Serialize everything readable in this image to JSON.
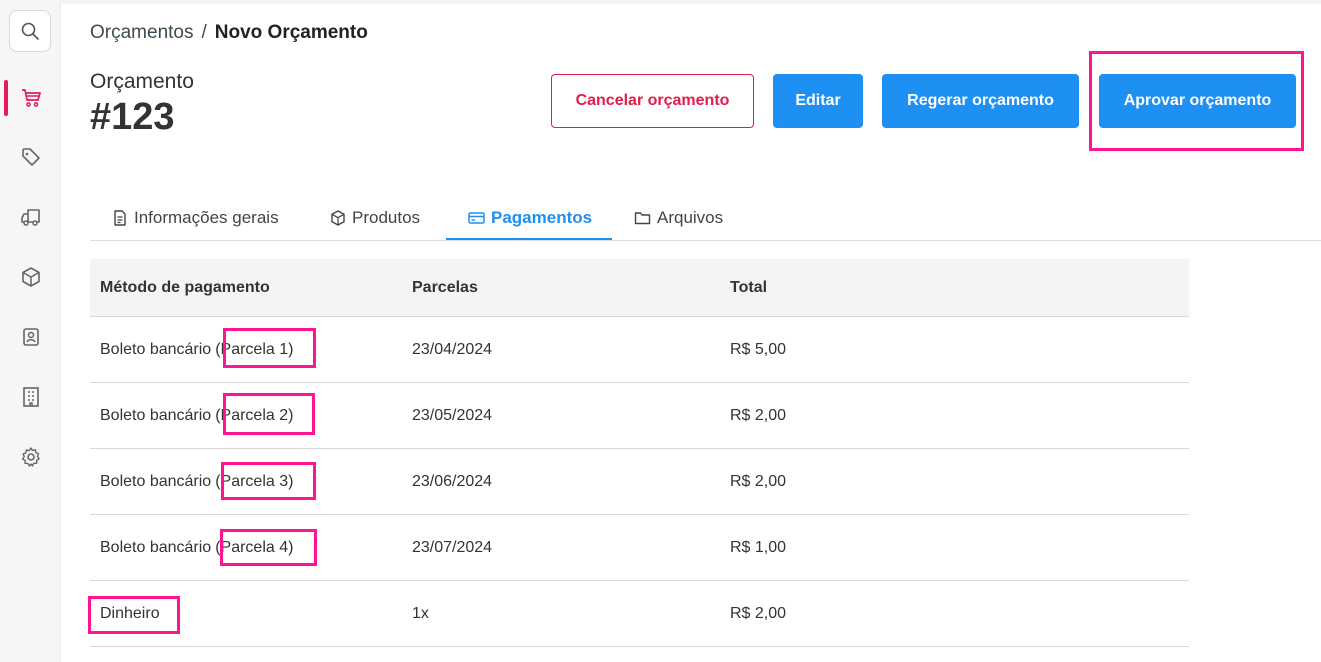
{
  "breadcrumb": {
    "parent": "Orçamentos",
    "separator": "/",
    "current": "Novo Orçamento"
  },
  "header": {
    "label": "Orçamento",
    "number": "#123"
  },
  "actions": {
    "cancel_label": "Cancelar orçamento",
    "edit_label": "Editar",
    "regen_label": "Regerar orçamento",
    "approve_label": "Aprovar orçamento"
  },
  "sidebar": {
    "items": [
      {
        "icon": "search-icon"
      },
      {
        "icon": "cart-icon",
        "active": true
      },
      {
        "icon": "tag-icon"
      },
      {
        "icon": "truck-icon"
      },
      {
        "icon": "box-icon"
      },
      {
        "icon": "contact-icon"
      },
      {
        "icon": "building-icon"
      },
      {
        "icon": "gear-icon"
      }
    ]
  },
  "tabs": [
    {
      "label": "Informações gerais",
      "icon": "document-icon"
    },
    {
      "label": "Produtos",
      "icon": "box-icon"
    },
    {
      "label": "Pagamentos",
      "icon": "card-icon",
      "active": true
    },
    {
      "label": "Arquivos",
      "icon": "folder-icon"
    }
  ],
  "table": {
    "headers": [
      "Método de pagamento",
      "Parcelas",
      "Total"
    ],
    "rows": [
      {
        "method": "Boleto bancário",
        "detail": "(Parcela 1)",
        "installments": "23/04/2024",
        "total": "R$ 5,00"
      },
      {
        "method": "Boleto bancário",
        "detail": "(Parcela 2)",
        "installments": "23/05/2024",
        "total": "R$ 2,00"
      },
      {
        "method": "Boleto bancário",
        "detail": "(Parcela 3)",
        "installments": "23/06/2024",
        "total": "R$ 2,00"
      },
      {
        "method": "Boleto bancário",
        "detail": "(Parcela 4)",
        "installments": "23/07/2024",
        "total": "R$ 1,00"
      },
      {
        "method": "Dinheiro",
        "detail": "",
        "installments": "1x",
        "total": "R$ 2,00"
      }
    ]
  },
  "colors": {
    "primary": "#1e90f3",
    "danger": "#e01e4c",
    "highlight": "#ff1493",
    "active_nav": "#e7195a"
  }
}
